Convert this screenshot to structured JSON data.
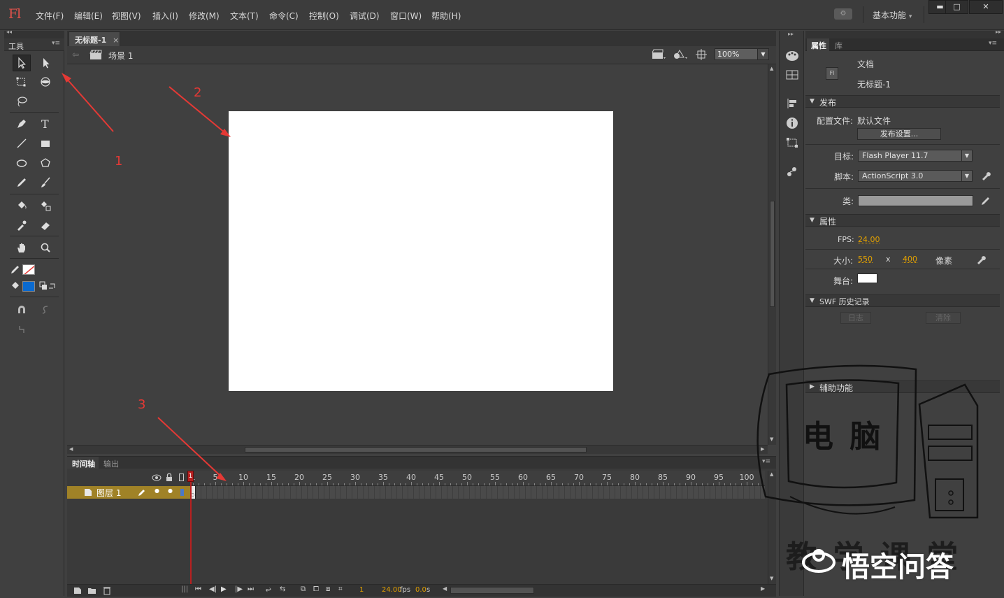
{
  "app": {
    "logo": "Fl",
    "workspace": "基本功能",
    "workspace_caret": "▾",
    "sync_label": "⚙"
  },
  "window_controls": {
    "minimize": "▬",
    "maximize": "□",
    "close": "✕"
  },
  "menu": [
    "文件(F)",
    "编辑(E)",
    "视图(V)",
    "插入(I)",
    "修改(M)",
    "文本(T)",
    "命令(C)",
    "控制(O)",
    "调试(D)",
    "窗口(W)",
    "帮助(H)"
  ],
  "tools_panel": {
    "title": "工具"
  },
  "document": {
    "tab_label": "无标题-1",
    "tab_close": "×",
    "scene": "场景 1",
    "zoom": "100%"
  },
  "timeline": {
    "tabs": [
      "时间轴",
      "输出"
    ],
    "ruler": [
      "1",
      "5",
      "10",
      "15",
      "20",
      "25",
      "30",
      "35",
      "40",
      "45",
      "50",
      "55",
      "60",
      "65",
      "70",
      "75",
      "80",
      "85",
      "90",
      "95",
      "100"
    ],
    "layer_name": "图层 1",
    "current_frame": "1",
    "fps": "24.00",
    "fps_unit": "fps",
    "time": "0.0",
    "time_unit": "s"
  },
  "properties": {
    "tabs": [
      "属性",
      "库"
    ],
    "doc_type": "文档",
    "doc_name": "无标题-1",
    "doc_icon_text": "Fl",
    "publish": {
      "title": "发布",
      "profile_label": "配置文件:",
      "profile_value": "默认文件",
      "settings_button": "发布设置...",
      "target_label": "目标:",
      "target_value": "Flash Player 11.7",
      "script_label": "脚本:",
      "script_value": "ActionScript 3.0",
      "class_label": "类:"
    },
    "props": {
      "title": "属性",
      "fps_label": "FPS:",
      "fps_value": "24.00",
      "size_label": "大小:",
      "width": "550",
      "x": "x",
      "height": "400",
      "unit": "像素",
      "stage_label": "舞台:",
      "stage_color": "#ffffff"
    },
    "swf": {
      "title": "SWF 历史记录",
      "log_button": "日志",
      "clear_button": "清除"
    },
    "accessibility": {
      "title": "辅助功能"
    }
  },
  "annotations": [
    "1",
    "2",
    "3"
  ],
  "watermark": {
    "computer_text": "电 脑",
    "bottom_text": "教 学 课 堂",
    "brand": "悟空问答"
  },
  "colors": {
    "accent_red": "#e53935",
    "layer_row": "#a08227",
    "fill_color": "#0a6ad0",
    "playhead": "#b82020"
  }
}
